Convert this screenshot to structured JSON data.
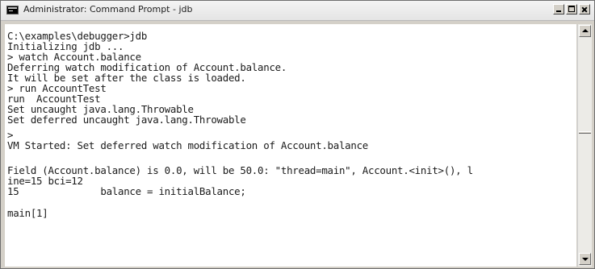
{
  "window": {
    "title": "Administrator: Command Prompt - jdb",
    "icon": "console-icon",
    "controls": {
      "minimize": "minimize-icon",
      "maximize": "maximize-icon",
      "close": "close-icon"
    }
  },
  "console": {
    "background": "#ffffff",
    "text_color": "#1a1a1a",
    "lines": [
      "C:\\examples\\debugger>jdb",
      "Initializing jdb ...",
      "> watch Account.balance",
      "Deferring watch modification of Account.balance.",
      "It will be set after the class is loaded.",
      "> run AccountTest",
      "run  AccountTest",
      "Set uncaught java.lang.Throwable",
      "Set deferred uncaught java.lang.Throwable",
      ">",
      "VM Started: Set deferred watch modification of Account.balance",
      "",
      "Field (Account.balance) is 0.0, will be 50.0: \"thread=main\", Account.<init>(), l",
      "ine=15 bci=12",
      "15              balance = initialBalance;",
      "",
      "main[1]"
    ]
  },
  "scrollbar": {
    "up_icon": "arrow-up-icon",
    "down_icon": "arrow-down-icon"
  }
}
